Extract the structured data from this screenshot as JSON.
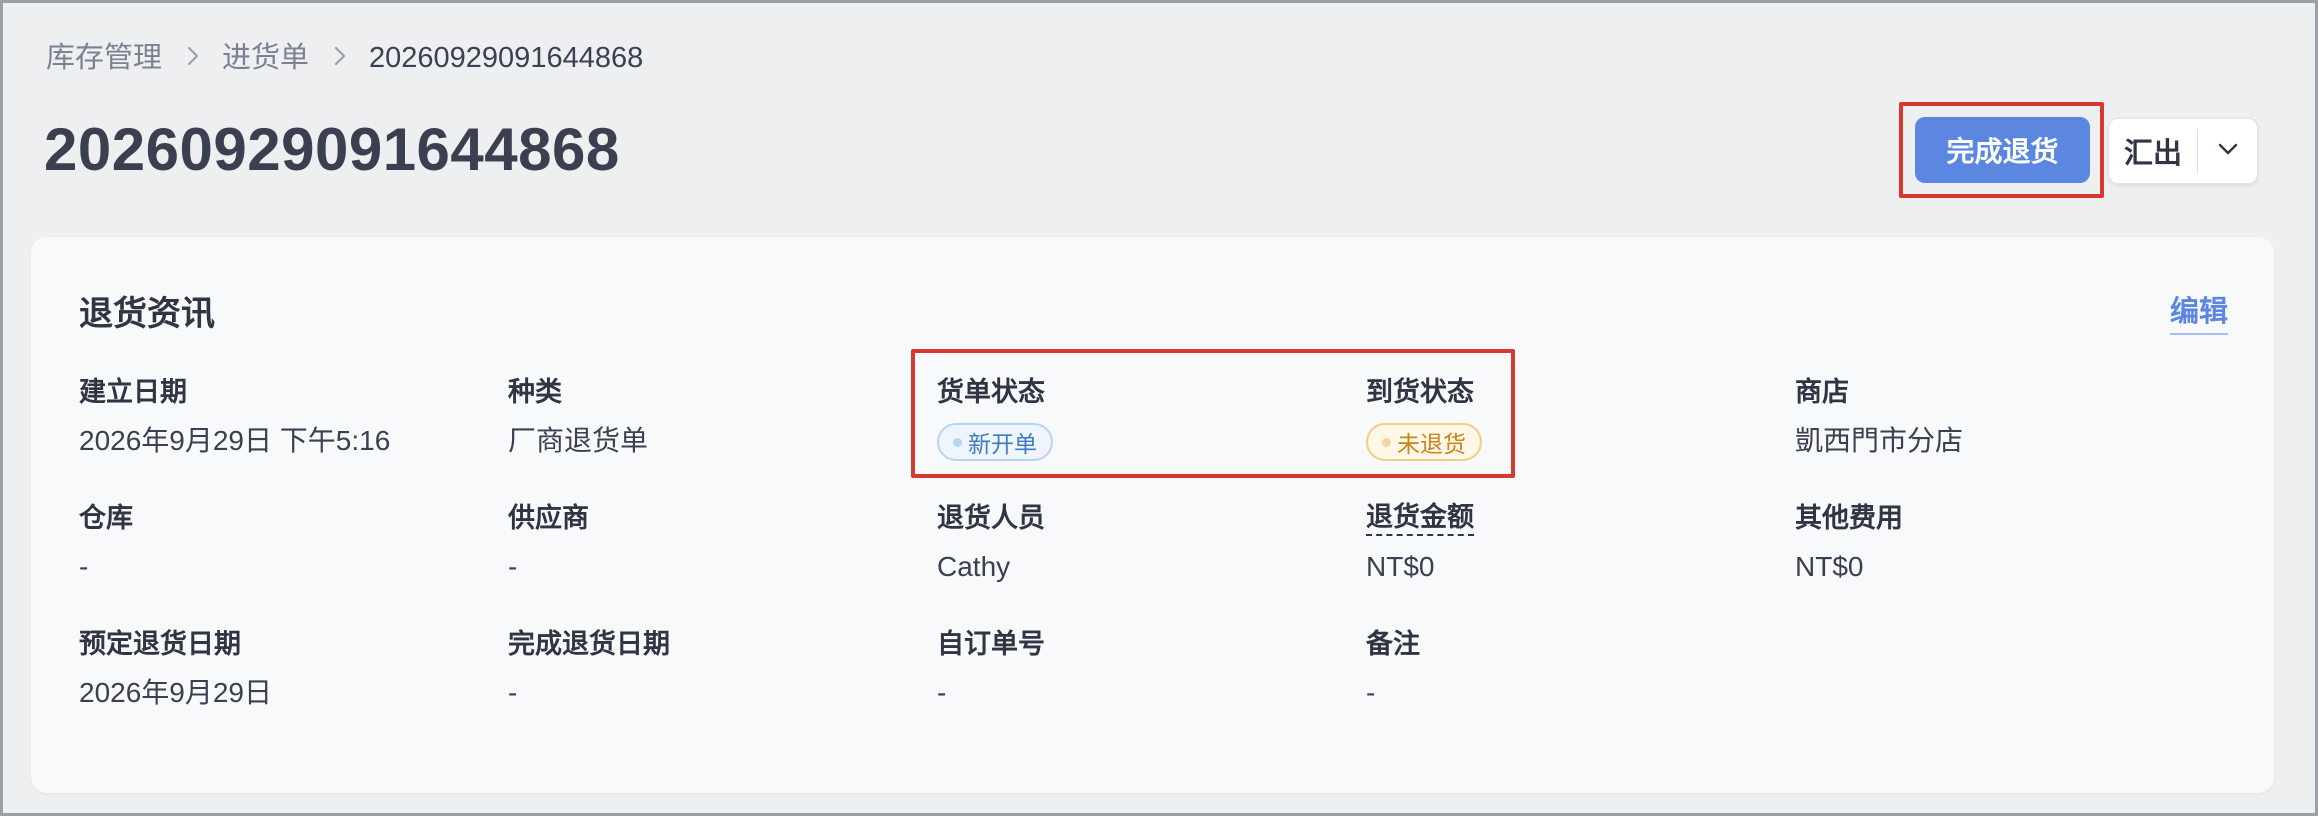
{
  "breadcrumb": {
    "items": [
      "库存管理",
      "进货单"
    ],
    "current": "20260929091644868"
  },
  "page_title": "20260929091644868",
  "actions": {
    "primary_label": "完成退货",
    "export_label": "汇出",
    "dropdown_icon": "chevron-down-icon"
  },
  "card": {
    "title": "退货资讯",
    "edit_label": "编辑",
    "fields": {
      "created_date": {
        "label": "建立日期",
        "value": "2026年9月29日 下午5:16"
      },
      "type": {
        "label": "种类",
        "value": "厂商退货单"
      },
      "order_status": {
        "label": "货单状态",
        "value": "新开单"
      },
      "arrival_status": {
        "label": "到货状态",
        "value": "未退货"
      },
      "store": {
        "label": "商店",
        "value": "凱西門市分店"
      },
      "warehouse": {
        "label": "仓库",
        "value": "-"
      },
      "supplier": {
        "label": "供应商",
        "value": "-"
      },
      "return_staff": {
        "label": "退货人员",
        "value": "Cathy"
      },
      "return_amount": {
        "label": "退货金额",
        "value": "NT$0"
      },
      "other_fees": {
        "label": "其他费用",
        "value": "NT$0"
      },
      "scheduled_return_date": {
        "label": "预定退货日期",
        "value": "2026年9月29日"
      },
      "completed_return_date": {
        "label": "完成退货日期",
        "value": "-"
      },
      "custom_order_no": {
        "label": "自订单号",
        "value": "-"
      },
      "notes": {
        "label": "备注",
        "value": "-"
      }
    }
  },
  "colors": {
    "primary": "#5b87e0",
    "highlight": "#d63a2f",
    "status_blue": "#3f7bbf",
    "status_orange": "#c9841a"
  }
}
